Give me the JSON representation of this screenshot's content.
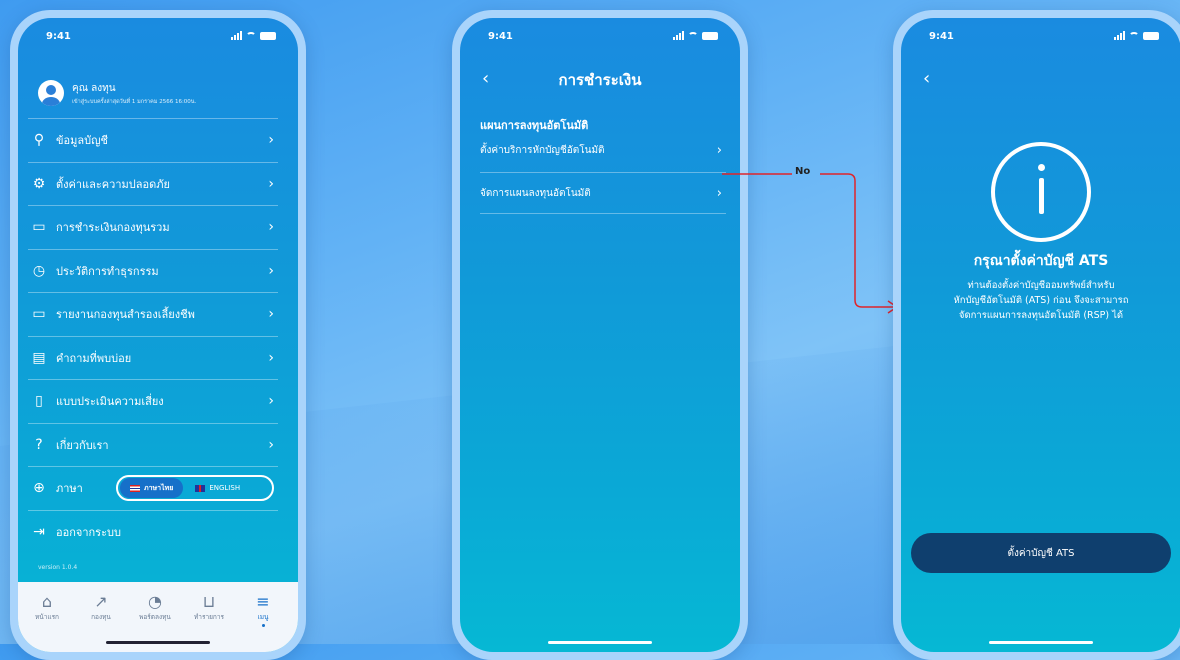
{
  "colors": {
    "accent": "#1670c9",
    "connector": "#e0242a",
    "button_dark": "#0f3f6e"
  },
  "status_time": "9:41",
  "phone1": {
    "user_name": "คุณ ลงทุน",
    "last_login": "เข้าสู่ระบบครั้งล่าสุดวันที่ 1 มกราคม 2566 16:00น.",
    "menu": [
      {
        "label": "ข้อมูลบัญชี",
        "icon": "person-icon"
      },
      {
        "label": "ตั้งค่าและความปลอดภัย",
        "icon": "gear-icon"
      },
      {
        "label": "การชำระเงินกองทุนรวม",
        "icon": "card-icon"
      },
      {
        "label": "ประวัติการทำธุรกรรม",
        "icon": "clock-icon"
      },
      {
        "label": "รายงานกองทุนสำรองเลี้ยงชีพ",
        "icon": "folder-icon"
      },
      {
        "label": "คำถามที่พบบ่อย",
        "icon": "chat-icon"
      },
      {
        "label": "แบบประเมินความเสี่ยง",
        "icon": "document-icon"
      },
      {
        "label": "เกี่ยวกับเรา",
        "icon": "help-icon"
      }
    ],
    "language_label": "ภาษา",
    "lang_thai": "ภาษาไทย",
    "lang_english": "ENGLISH",
    "logout_label": "ออกจากระบบ",
    "version": "version 1.0.4",
    "tabs": [
      {
        "label": "หน้าแรก",
        "icon": "home-icon"
      },
      {
        "label": "กองทุน",
        "icon": "trend-icon"
      },
      {
        "label": "พอร์ตลงทุน",
        "icon": "pie-icon"
      },
      {
        "label": "ทำรายการ",
        "icon": "cart-icon"
      },
      {
        "label": "เมนู",
        "icon": "menu-icon"
      }
    ]
  },
  "phone2": {
    "title": "การชำระเงิน",
    "section": "แผนการลงทุนอัตโนมัติ",
    "row1": "ตั้งค่าบริการหักบัญชีอัตโนมัติ",
    "row2": "จัดการแผนลงทุนอัตโนมัติ"
  },
  "connector_label": "No",
  "phone3": {
    "heading": "กรุณาตั้งค่าบัญชี ATS",
    "body_line1": "ท่านต้องตั้งค่าบัญชีออมทรัพย์สำหรับ",
    "body_line2": "หักบัญชีอัตโนมัติ (ATS) ก่อน จึงจะสามารถ",
    "body_line3": "จัดการแผนการลงทุนอัตโนมัติ (RSP) ได้",
    "button": "ตั้งค่าบัญชี ATS"
  }
}
